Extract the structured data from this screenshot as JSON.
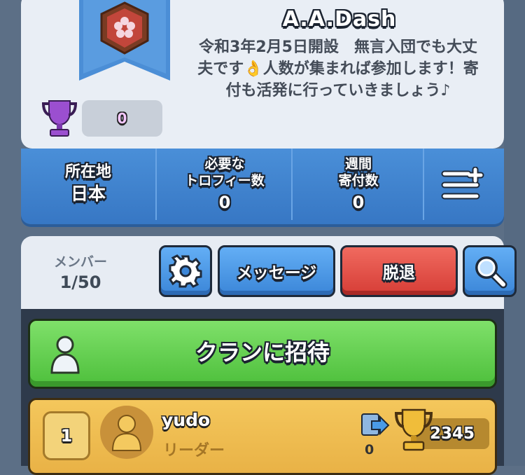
{
  "clan": {
    "name": "A.A.Dash",
    "description": "令和3年2月5日開設　無言入団でも大丈夫です👌人数が集まれば参加します！寄付も活発に行っていきましょう♪",
    "trophies": "0"
  },
  "stats": {
    "location_label": "所在地",
    "location_value": "日本",
    "required_label_1": "必要な",
    "required_label_2": "トロフィー数",
    "required_value": "0",
    "donations_label_1": "週間",
    "donations_label_2": "寄付数",
    "donations_value": "0",
    "menu_icon": "menu-plus-icon"
  },
  "members_panel": {
    "label": "メンバー",
    "count": "1/50",
    "settings_icon": "gear-icon",
    "messages_label": "メッセージ",
    "leave_label": "脱退",
    "search_icon": "search-icon"
  },
  "invite": {
    "label": "クランに招待",
    "icon": "person-icon"
  },
  "members": [
    {
      "rank": "1",
      "name": "yudo",
      "role": "リーダー",
      "donations": "0",
      "trophies": "2345"
    }
  ],
  "colors": {
    "stats_blue": "#3f85d0",
    "leave_red": "#e0493f",
    "invite_green": "#5ccc46",
    "member_gold": "#efbd52"
  }
}
